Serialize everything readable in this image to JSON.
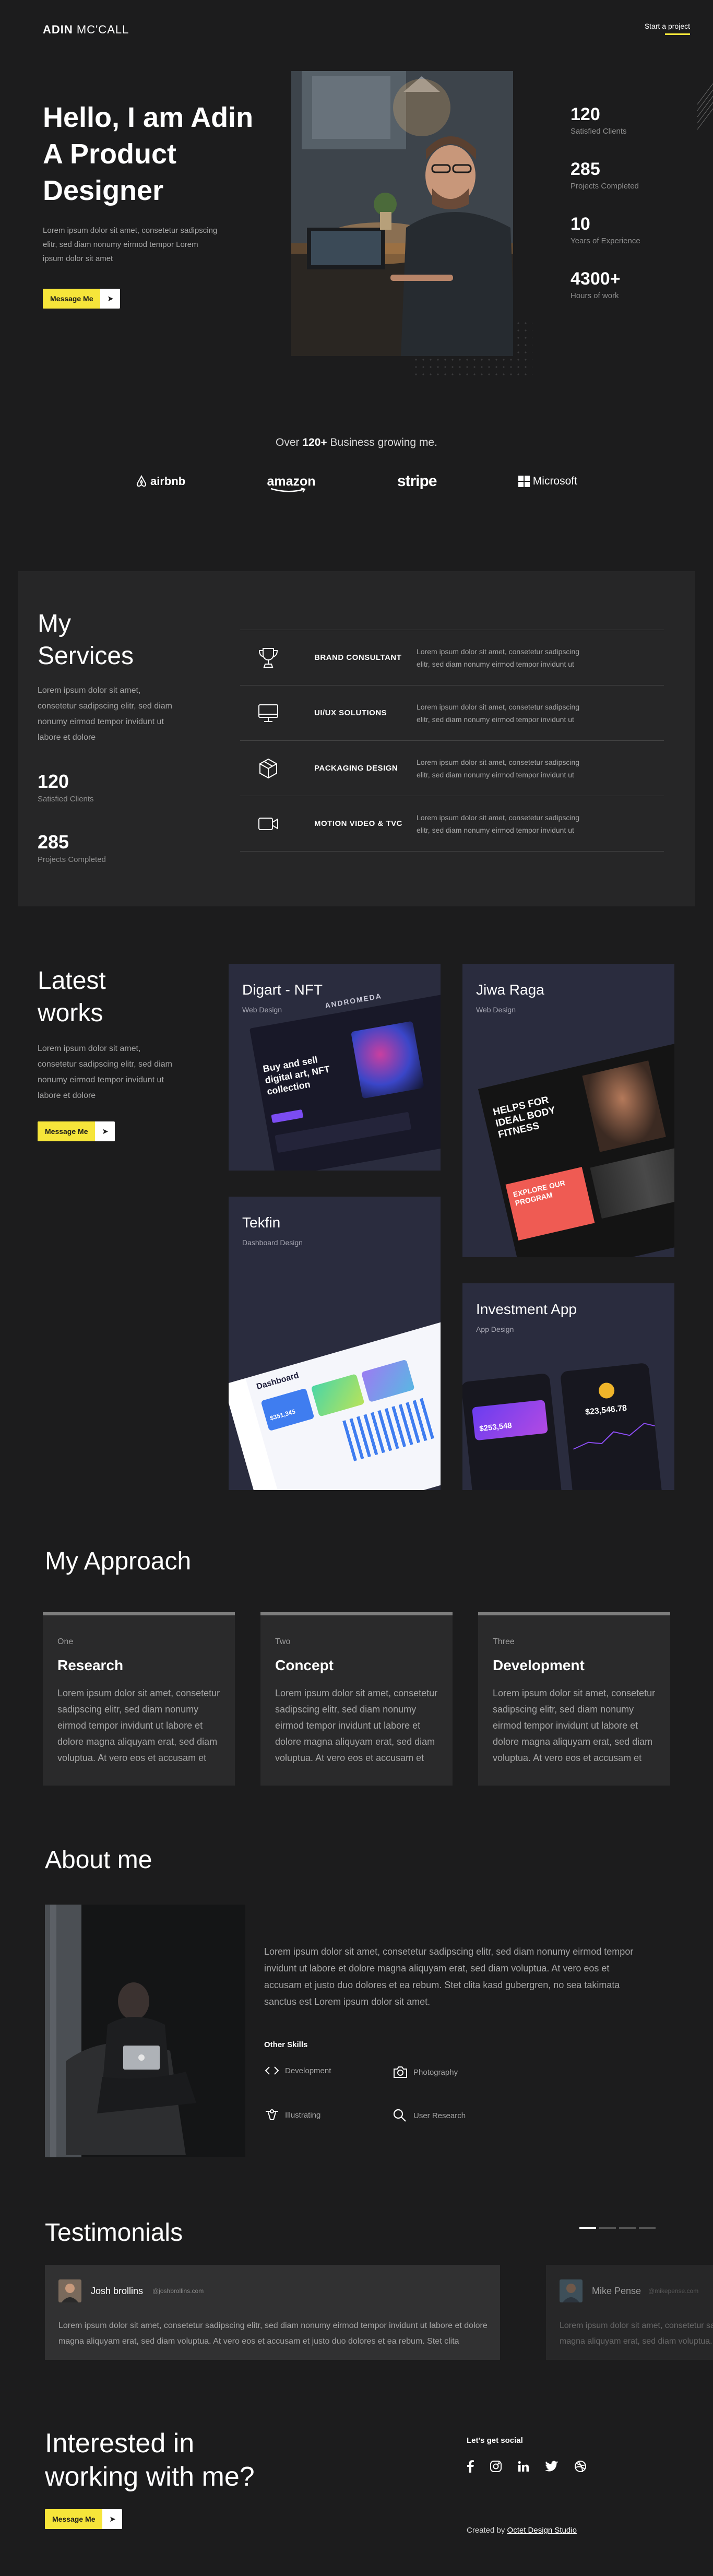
{
  "header": {
    "brand_bold": "ADIN",
    "brand_light": " MC'CALL",
    "cta": "Start a project"
  },
  "hero": {
    "title": "Hello, I am Adin A Product Designer",
    "description": "Lorem ipsum dolor sit amet, consetetur sadipscing elitr, sed diam nonumy eirmod tempor Lorem ipsum dolor sit amet",
    "button_label": "Message Me",
    "stats": [
      {
        "value": "120",
        "label": "Satisfied Clients"
      },
      {
        "value": "285",
        "label": "Projects Completed"
      },
      {
        "value": "10",
        "label": "Years of Experience"
      },
      {
        "value": "4300+",
        "label": "Hours of work"
      }
    ]
  },
  "clients": {
    "text_prefix": "Over ",
    "text_bold": "120+",
    "text_suffix": " Business growing me.",
    "logos": [
      "airbnb",
      "amazon",
      "stripe",
      "Microsoft"
    ]
  },
  "services": {
    "title": "My Services",
    "description": "Lorem ipsum dolor sit amet, consetetur sadipscing elitr, sed diam nonumy eirmod tempor invidunt ut labore et dolore",
    "stats": [
      {
        "value": "120",
        "label": "Satisfied Clients"
      },
      {
        "value": "285",
        "label": "Projects Completed"
      }
    ],
    "items": [
      {
        "icon": "trophy-icon",
        "name": "BRAND CONSULTANT",
        "desc": "Lorem ipsum dolor sit amet, consetetur sadipscing elitr, sed diam nonumy eirmod tempor invidunt ut"
      },
      {
        "icon": "monitor-icon",
        "name": "UI/UX SOLUTIONS",
        "desc": "Lorem ipsum dolor sit amet, consetetur sadipscing elitr, sed diam nonumy eirmod tempor invidunt ut"
      },
      {
        "icon": "package-icon",
        "name": "PACKAGING DESIGN",
        "desc": "Lorem ipsum dolor sit amet, consetetur sadipscing elitr, sed diam nonumy eirmod tempor invidunt ut"
      },
      {
        "icon": "video-icon",
        "name": "MOTION VIDEO & TVC",
        "desc": "Lorem ipsum dolor sit amet, consetetur sadipscing elitr, sed diam nonumy eirmod tempor invidunt ut"
      }
    ]
  },
  "works": {
    "title": "Latest works",
    "description": "Lorem ipsum dolor sit amet, consetetur sadipscing elitr, sed diam nonumy eirmod tempor invidunt ut labore et dolore",
    "button_label": "Message Me",
    "cards": [
      {
        "title": "Digart - NFT",
        "subtitle": "Web Design",
        "mock_text": "Buy and sell digital art, NFT collection",
        "mock_banner": "ANDROMEDA"
      },
      {
        "title": "Jiwa Raga",
        "subtitle": "Web Design",
        "mock_text": "HELPS FOR IDEAL BODY FITNESS",
        "mock_text2": "EXPLORE OUR PROGRAM"
      },
      {
        "title": "Tekfin",
        "subtitle": "Dashboard Design",
        "mock_text": "Dashboard",
        "mock_value": "$351,345"
      },
      {
        "title": "Investment App",
        "subtitle": "App Design",
        "mock_value": "$253,548",
        "mock_value2": "$23,546.78"
      }
    ]
  },
  "approach": {
    "title": "My Approach",
    "items": [
      {
        "num": "One",
        "title": "Research",
        "desc": "Lorem ipsum dolor sit amet, consetetur sadipscing elitr, sed diam nonumy eirmod tempor invidunt ut labore et dolore magna aliquyam erat, sed diam voluptua. At vero eos et accusam et"
      },
      {
        "num": "Two",
        "title": "Concept",
        "desc": "Lorem ipsum dolor sit amet, consetetur sadipscing elitr, sed diam nonumy eirmod tempor invidunt ut labore et dolore magna aliquyam erat, sed diam voluptua. At vero eos et accusam et"
      },
      {
        "num": "Three",
        "title": "Development",
        "desc": "Lorem ipsum dolor sit amet, consetetur sadipscing elitr, sed diam nonumy eirmod tempor invidunt ut labore et dolore magna aliquyam erat, sed diam voluptua. At vero eos et accusam et"
      }
    ]
  },
  "about": {
    "title": "About me",
    "description": "Lorem ipsum dolor sit amet, consetetur sadipscing elitr, sed diam nonumy eirmod tempor invidunt ut labore et dolore magna aliquyam erat, sed diam voluptua. At vero eos et accusam et justo duo dolores et ea rebum. Stet clita kasd gubergren, no sea takimata sanctus est Lorem ipsum dolor sit amet.",
    "skills_title": "Other Skills",
    "skills": [
      {
        "icon": "code-icon",
        "label": "Development"
      },
      {
        "icon": "camera-icon",
        "label": "Photography"
      },
      {
        "icon": "pen-tool-icon",
        "label": "Illustrating"
      },
      {
        "icon": "search-icon",
        "label": "User Research"
      }
    ]
  },
  "testimonials": {
    "title": "Testimonials",
    "items": [
      {
        "name": "Josh brollins",
        "handle": "@joshbrollins.com",
        "text": "Lorem ipsum dolor sit amet, consetetur sadipscing elitr, sed diam nonumy eirmod tempor invidunt ut labore et dolore magna aliquyam erat, sed diam voluptua. At vero eos et accusam et justo duo dolores et ea rebum. Stet clita"
      },
      {
        "name": "Mike Pense",
        "handle": "@mikepense.com",
        "text": "Lorem ipsum dolor sit amet, consetetur sadipscing elitr, sed diam nonumy eirmod tempor invidunt ut labore et dolore magna aliquyam erat, sed diam voluptua. At vero eos et accusam et justo duo dolores et ea rebum. Stet clita"
      }
    ]
  },
  "contact": {
    "title": "Interested in working with me?",
    "button_label": "Message Me",
    "social_title": "Let's get social",
    "social": [
      "facebook-icon",
      "instagram-icon",
      "linkedin-icon",
      "twitter-icon",
      "dribbble-icon"
    ],
    "credit_prefix": "Created by ",
    "credit_link": "Octet Design Studio"
  },
  "colors": {
    "background": "#1c1c1d",
    "accent": "#f6e53a",
    "panel": "#262627",
    "card": "#2a2c3e"
  }
}
